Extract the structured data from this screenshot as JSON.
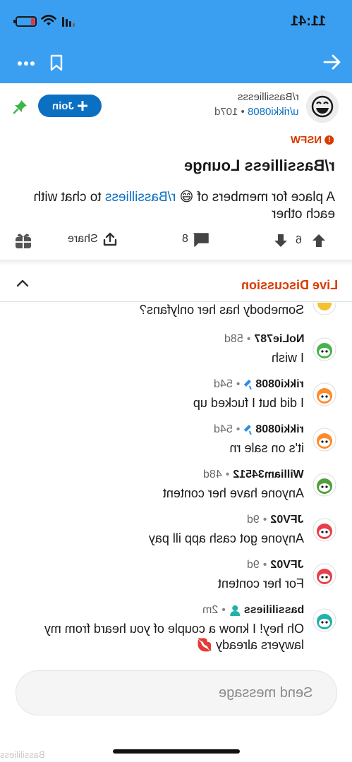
{
  "status_bar": {
    "time": "11:41"
  },
  "app_bar": {
    "icons": [
      "more-icon",
      "bookmark-icon",
      "forward-arrow-icon"
    ]
  },
  "post": {
    "subreddit": "r/Bassilliesss",
    "author": "u/rikki0808",
    "age": "107d",
    "join_label": "Join",
    "nsfw_label": "NSFW",
    "title": "r/Bassilliess Lounge",
    "body_before": "A place for members of",
    "body_sub": "r/Bassilliess",
    "body_after": "to chat with each other",
    "vote_count": "6",
    "comment_count": "8",
    "share_label": "Share"
  },
  "live": {
    "title": "Live Discussion"
  },
  "messages": [
    {
      "author": "",
      "age": "",
      "text": "Somebody has her onlyfans?",
      "avatar_color": "#f2c230"
    },
    {
      "author": "NoLie787",
      "age": "58d",
      "text": "I wish",
      "avatar_color": "#45b54a"
    },
    {
      "author": "rikki0808",
      "age": "54d",
      "text": "I did but I fucked up",
      "avatar_color": "#ff8a2a",
      "mic": true
    },
    {
      "author": "rikki0808",
      "age": "54d",
      "text": "it's on sale rn",
      "avatar_color": "#ff8a2a",
      "mic": true
    },
    {
      "author": "William34512",
      "age": "48d",
      "text": "Anyone have her content",
      "avatar_color": "#4f9f3b"
    },
    {
      "author": "JFV02",
      "age": "9d",
      "text": "Anyone got cash app ill pay",
      "avatar_color": "#e8404a"
    },
    {
      "author": "JFV02",
      "age": "9d",
      "text": "For her content",
      "avatar_color": "#e8404a"
    },
    {
      "author": "bassililiess",
      "age": "2m",
      "text": "Oh hey! I know a couple of you heard from my lawyers already 💋",
      "avatar_color": "#20b2aa",
      "mod": true
    }
  ],
  "composer": {
    "placeholder": "Send message"
  },
  "watermark": "Bassililiess",
  "colors": {
    "brand_blue": "#3a9ff1",
    "join_blue": "#0b6fc2",
    "nsfw_red": "#d93a00"
  }
}
